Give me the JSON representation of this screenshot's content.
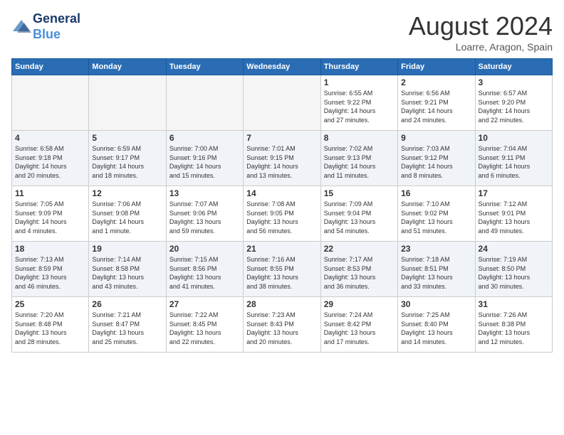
{
  "header": {
    "logo_line1": "General",
    "logo_line2": "Blue",
    "month": "August 2024",
    "location": "Loarre, Aragon, Spain"
  },
  "days_of_week": [
    "Sunday",
    "Monday",
    "Tuesday",
    "Wednesday",
    "Thursday",
    "Friday",
    "Saturday"
  ],
  "weeks": [
    {
      "days": [
        {
          "num": "",
          "info": ""
        },
        {
          "num": "",
          "info": ""
        },
        {
          "num": "",
          "info": ""
        },
        {
          "num": "",
          "info": ""
        },
        {
          "num": "1",
          "info": "Sunrise: 6:55 AM\nSunset: 9:22 PM\nDaylight: 14 hours\nand 27 minutes."
        },
        {
          "num": "2",
          "info": "Sunrise: 6:56 AM\nSunset: 9:21 PM\nDaylight: 14 hours\nand 24 minutes."
        },
        {
          "num": "3",
          "info": "Sunrise: 6:57 AM\nSunset: 9:20 PM\nDaylight: 14 hours\nand 22 minutes."
        }
      ]
    },
    {
      "days": [
        {
          "num": "4",
          "info": "Sunrise: 6:58 AM\nSunset: 9:18 PM\nDaylight: 14 hours\nand 20 minutes."
        },
        {
          "num": "5",
          "info": "Sunrise: 6:59 AM\nSunset: 9:17 PM\nDaylight: 14 hours\nand 18 minutes."
        },
        {
          "num": "6",
          "info": "Sunrise: 7:00 AM\nSunset: 9:16 PM\nDaylight: 14 hours\nand 15 minutes."
        },
        {
          "num": "7",
          "info": "Sunrise: 7:01 AM\nSunset: 9:15 PM\nDaylight: 14 hours\nand 13 minutes."
        },
        {
          "num": "8",
          "info": "Sunrise: 7:02 AM\nSunset: 9:13 PM\nDaylight: 14 hours\nand 11 minutes."
        },
        {
          "num": "9",
          "info": "Sunrise: 7:03 AM\nSunset: 9:12 PM\nDaylight: 14 hours\nand 8 minutes."
        },
        {
          "num": "10",
          "info": "Sunrise: 7:04 AM\nSunset: 9:11 PM\nDaylight: 14 hours\nand 6 minutes."
        }
      ]
    },
    {
      "days": [
        {
          "num": "11",
          "info": "Sunrise: 7:05 AM\nSunset: 9:09 PM\nDaylight: 14 hours\nand 4 minutes."
        },
        {
          "num": "12",
          "info": "Sunrise: 7:06 AM\nSunset: 9:08 PM\nDaylight: 14 hours\nand 1 minute."
        },
        {
          "num": "13",
          "info": "Sunrise: 7:07 AM\nSunset: 9:06 PM\nDaylight: 13 hours\nand 59 minutes."
        },
        {
          "num": "14",
          "info": "Sunrise: 7:08 AM\nSunset: 9:05 PM\nDaylight: 13 hours\nand 56 minutes."
        },
        {
          "num": "15",
          "info": "Sunrise: 7:09 AM\nSunset: 9:04 PM\nDaylight: 13 hours\nand 54 minutes."
        },
        {
          "num": "16",
          "info": "Sunrise: 7:10 AM\nSunset: 9:02 PM\nDaylight: 13 hours\nand 51 minutes."
        },
        {
          "num": "17",
          "info": "Sunrise: 7:12 AM\nSunset: 9:01 PM\nDaylight: 13 hours\nand 49 minutes."
        }
      ]
    },
    {
      "days": [
        {
          "num": "18",
          "info": "Sunrise: 7:13 AM\nSunset: 8:59 PM\nDaylight: 13 hours\nand 46 minutes."
        },
        {
          "num": "19",
          "info": "Sunrise: 7:14 AM\nSunset: 8:58 PM\nDaylight: 13 hours\nand 43 minutes."
        },
        {
          "num": "20",
          "info": "Sunrise: 7:15 AM\nSunset: 8:56 PM\nDaylight: 13 hours\nand 41 minutes."
        },
        {
          "num": "21",
          "info": "Sunrise: 7:16 AM\nSunset: 8:55 PM\nDaylight: 13 hours\nand 38 minutes."
        },
        {
          "num": "22",
          "info": "Sunrise: 7:17 AM\nSunset: 8:53 PM\nDaylight: 13 hours\nand 36 minutes."
        },
        {
          "num": "23",
          "info": "Sunrise: 7:18 AM\nSunset: 8:51 PM\nDaylight: 13 hours\nand 33 minutes."
        },
        {
          "num": "24",
          "info": "Sunrise: 7:19 AM\nSunset: 8:50 PM\nDaylight: 13 hours\nand 30 minutes."
        }
      ]
    },
    {
      "days": [
        {
          "num": "25",
          "info": "Sunrise: 7:20 AM\nSunset: 8:48 PM\nDaylight: 13 hours\nand 28 minutes."
        },
        {
          "num": "26",
          "info": "Sunrise: 7:21 AM\nSunset: 8:47 PM\nDaylight: 13 hours\nand 25 minutes."
        },
        {
          "num": "27",
          "info": "Sunrise: 7:22 AM\nSunset: 8:45 PM\nDaylight: 13 hours\nand 22 minutes."
        },
        {
          "num": "28",
          "info": "Sunrise: 7:23 AM\nSunset: 8:43 PM\nDaylight: 13 hours\nand 20 minutes."
        },
        {
          "num": "29",
          "info": "Sunrise: 7:24 AM\nSunset: 8:42 PM\nDaylight: 13 hours\nand 17 minutes."
        },
        {
          "num": "30",
          "info": "Sunrise: 7:25 AM\nSunset: 8:40 PM\nDaylight: 13 hours\nand 14 minutes."
        },
        {
          "num": "31",
          "info": "Sunrise: 7:26 AM\nSunset: 8:38 PM\nDaylight: 13 hours\nand 12 minutes."
        }
      ]
    }
  ]
}
